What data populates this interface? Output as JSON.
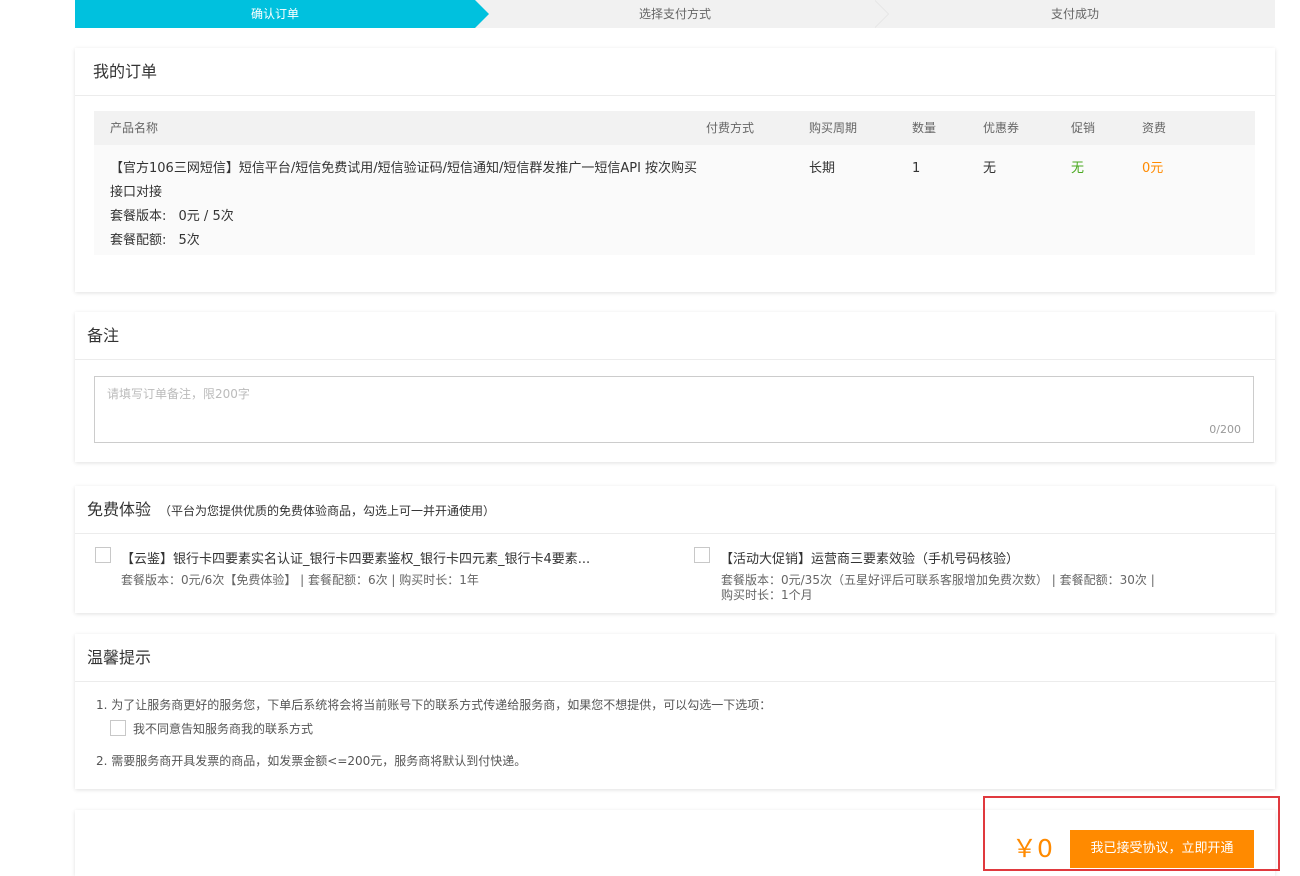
{
  "steps": [
    "确认订单",
    "选择支付方式",
    "支付成功"
  ],
  "order": {
    "title": "我的订单",
    "headers": {
      "product": "产品名称",
      "payment": "付费方式",
      "period": "购买周期",
      "quantity": "数量",
      "coupon": "优惠券",
      "promotion": "促销",
      "fee": "资费"
    },
    "row": {
      "name_line1": "【官方106三网短信】短信平台/短信免费试用/短信验证码/短信通知/短信群发推广一短信API 按次购买",
      "name_line2": "接口对接",
      "version_label": "套餐版本:",
      "version_value": "0元 / 5次",
      "quota_label": "套餐配额:",
      "quota_value": "5次",
      "payment": "",
      "period": "长期",
      "quantity": "1",
      "coupon": "无",
      "promotion": "无",
      "fee": "0元"
    }
  },
  "remark": {
    "title": "备注",
    "placeholder": "请填写订单备注，限200字",
    "counter": "0/200"
  },
  "trial": {
    "title": "免费体验",
    "subtitle": "（平台为您提供优质的免费体验商品，勾选上可一并开通使用）",
    "items": [
      {
        "name": "【云鉴】银行卡四要素实名认证_银行卡四要素鉴权_银行卡四元素_银行卡4要素...",
        "meta1": "套餐版本：0元/6次【免费体验】 | 套餐配额：6次 | 购买时长：1年",
        "meta2": ""
      },
      {
        "name": "【活动大促销】运营商三要素效验（手机号码核验）",
        "meta1": "套餐版本：0元/35次（五星好评后可联系客服增加免费次数） | 套餐配额：30次 |",
        "meta2": "购买时长：1个月"
      }
    ]
  },
  "tips": {
    "title": "温馨提示",
    "item1": "1. 为了让服务商更好的服务您，下单后系统将会将当前账号下的联系方式传递给服务商，如果您不想提供，可以勾选一下选项：",
    "checkbox_label": "我不同意告知服务商我的联系方式",
    "item2": "2. 需要服务商开具发票的商品，如发票金额<=200元，服务商将默认到付快递。"
  },
  "footer": {
    "price": "￥0",
    "submit_label": "我已接受协议，立即开通"
  },
  "colors": {
    "accent": "#00c1de",
    "orange": "#ff8a00",
    "green": "#48a81d",
    "highlight": "#e0393e"
  }
}
